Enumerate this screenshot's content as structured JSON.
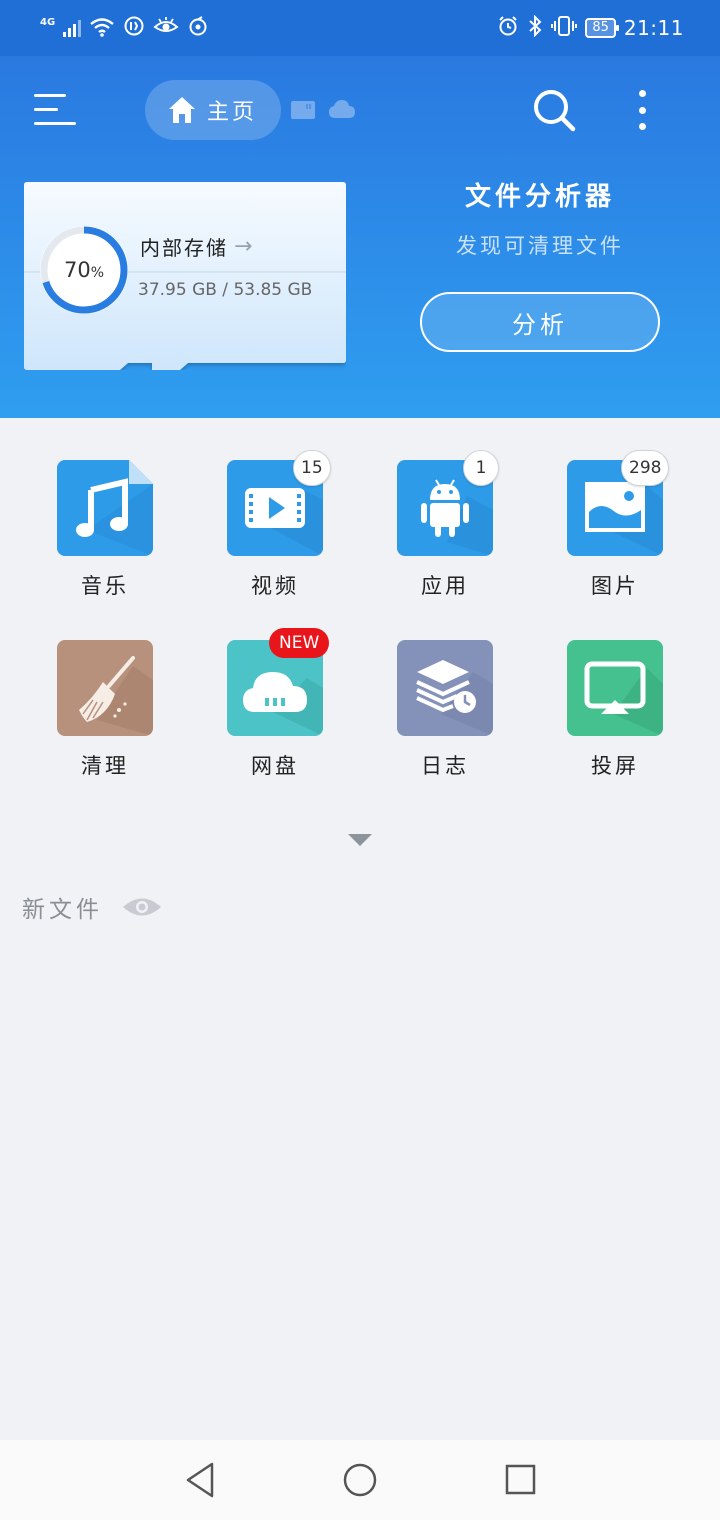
{
  "status_bar": {
    "network": "4G",
    "battery": "85",
    "time": "21:11"
  },
  "header": {
    "home_tab_label": "主页",
    "icons": [
      "menu-icon",
      "home-icon",
      "sd-card-icon",
      "cloud-icon",
      "search-icon",
      "more-vert-icon"
    ]
  },
  "storage": {
    "title": "内部存储",
    "arrow": "→",
    "percent": "70",
    "percent_sign": "%",
    "percent_value": 0.7,
    "size": "37.95 GB / 53.85 GB"
  },
  "analyzer": {
    "title": "文件分析器",
    "subtitle": "发现可清理文件",
    "button": "分析"
  },
  "categories": [
    {
      "label": "音乐",
      "icon": "music-icon",
      "color": "#2e9be8"
    },
    {
      "label": "视频",
      "icon": "video-icon",
      "color": "#2e9be8",
      "badge": "15"
    },
    {
      "label": "应用",
      "icon": "android-icon",
      "color": "#2e9be8",
      "badge": "1"
    },
    {
      "label": "图片",
      "icon": "image-icon",
      "color": "#2e9be8",
      "badge": "298"
    },
    {
      "label": "清理",
      "icon": "broom-icon",
      "color": "#b8917c"
    },
    {
      "label": "网盘",
      "icon": "cloud-drive-icon",
      "color": "#4cc3c6",
      "badge": "NEW"
    },
    {
      "label": "日志",
      "icon": "log-layers-icon",
      "color": "#8491b8"
    },
    {
      "label": "投屏",
      "icon": "cast-screen-icon",
      "color": "#45c08f"
    }
  ],
  "new_files": {
    "label": "新文件"
  },
  "nav": {
    "icons": [
      "back-icon",
      "home-circle-icon",
      "recents-icon"
    ]
  }
}
